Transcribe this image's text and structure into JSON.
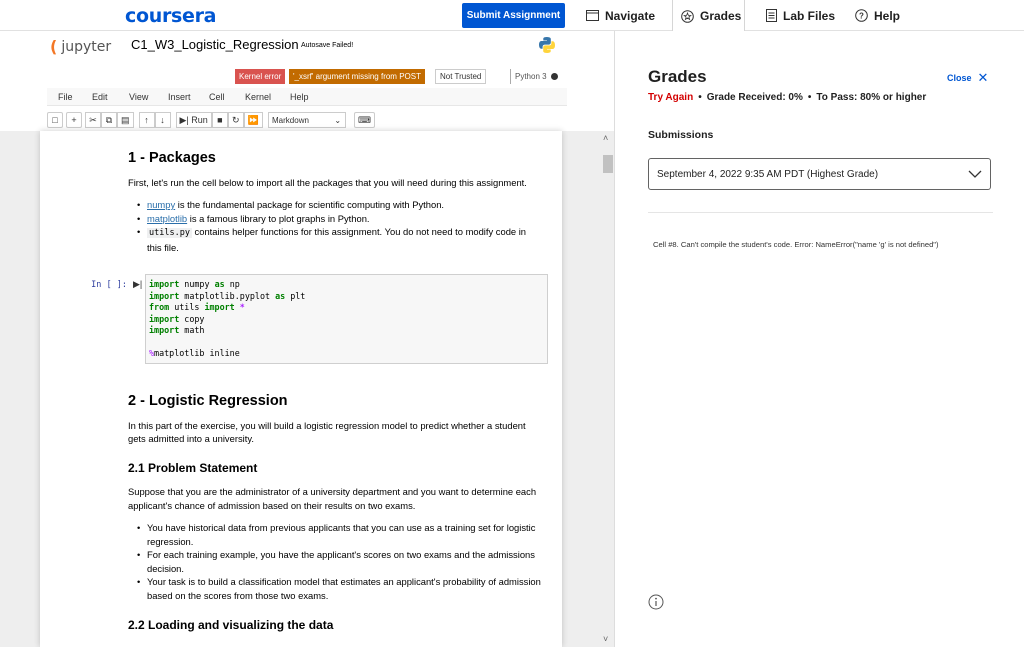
{
  "topbar": {
    "logo": "coursera",
    "submit_label": "Submit Assignment",
    "nav": [
      {
        "label": "Navigate",
        "icon": "window-icon"
      },
      {
        "label": "Grades",
        "icon": "grades-icon"
      },
      {
        "label": "Lab Files",
        "icon": "file-icon"
      },
      {
        "label": "Help",
        "icon": "help-circle-icon"
      }
    ]
  },
  "jupyter": {
    "brand": "jupyter",
    "notebook_title": "C1_W3_Logistic_Regression",
    "autosave": "Autosave Failed!",
    "badges": {
      "kernel_error": "Kernel error",
      "xsrf": "'_xsrf' argument missing from POST",
      "not_trusted": "Not Trusted",
      "kernel_name": "Python 3"
    },
    "menu": [
      "File",
      "Edit",
      "View",
      "Insert",
      "Cell",
      "Kernel",
      "Help"
    ],
    "toolbar": {
      "run_label": "Run",
      "cell_type": "Markdown"
    }
  },
  "notebook": {
    "sec1_title": "1 - Packages",
    "sec1_intro": "First, let's run the cell below to import all the packages that you will need during this assignment.",
    "sec1_b1_link": "numpy",
    "sec1_b1_rest": " is the fundamental package for scientific computing with Python.",
    "sec1_b2_link": "matplotlib",
    "sec1_b2_rest": " is a famous library to plot graphs in Python.",
    "sec1_b3_code": "utils.py",
    "sec1_b3_rest": " contains helper functions for this assignment. You do not need to modify code in this file.",
    "prompt": "In [ ]:",
    "code": {
      "l1_a": "import",
      "l1_b": " numpy ",
      "l1_c": "as",
      "l1_d": " np",
      "l2_a": "import",
      "l2_b": " matplotlib.pyplot ",
      "l2_c": "as",
      "l2_d": " plt",
      "l3_a": "from",
      "l3_b": " utils ",
      "l3_c": "import",
      "l3_d": "*",
      "l4_a": "import",
      "l4_b": " copy",
      "l5_a": "import",
      "l5_b": " math",
      "l7_a": "%",
      "l7_b": "matplotlib inline"
    },
    "sec2_title": "2 - Logistic Regression",
    "sec2_intro": "In this part of the exercise, you will build a logistic regression model to predict whether a student gets admitted into a university.",
    "sec21_title": "2.1 Problem Statement",
    "sec21_intro": "Suppose that you are the administrator of a university department and you want to determine each applicant's chance of admission based on their results on two exams.",
    "sec21_bullets": [
      "You have historical data from previous applicants that you can use as a training set for logistic regression.",
      "For each training example, you have the applicant's scores on two exams and the admissions decision.",
      "Your task is to build a classification model that estimates an applicant's probability of admission based on the scores from those two exams."
    ],
    "sec22_title": "2.2 Loading and visualizing the data"
  },
  "grades": {
    "title": "Grades",
    "close_label": "Close",
    "status": "Try Again",
    "received": "Grade Received: 0%",
    "to_pass": "To Pass: 80% or higher",
    "submissions_heading": "Submissions",
    "selected_submission": "September 4, 2022 9:35 AM PDT (Highest Grade)",
    "feedback": "Cell #8. Can't compile the student's code. Error: NameError(\"name 'g' is not defined\")"
  }
}
